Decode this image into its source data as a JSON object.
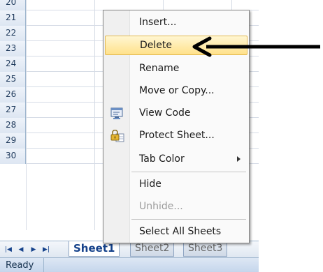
{
  "grid": {
    "rows": [
      "20",
      "21",
      "22",
      "23",
      "24",
      "25",
      "26",
      "27",
      "28",
      "29",
      "30"
    ]
  },
  "context_menu": {
    "items": [
      {
        "label": "Insert...",
        "state": "normal"
      },
      {
        "label": "Delete",
        "state": "highlighted"
      },
      {
        "label": "Rename",
        "state": "normal"
      },
      {
        "label": "Move or Copy...",
        "state": "normal"
      },
      {
        "label": "View Code",
        "state": "normal",
        "icon": "view-code-icon"
      },
      {
        "label": "Protect Sheet...",
        "state": "normal",
        "icon": "protect-sheet-icon"
      },
      {
        "label": "Tab Color",
        "state": "normal",
        "submenu": true
      },
      {
        "label": "Hide",
        "state": "normal"
      },
      {
        "label": "Unhide...",
        "state": "disabled"
      },
      {
        "label": "Select All Sheets",
        "state": "normal"
      }
    ]
  },
  "sheet_tabs": {
    "tabs": [
      "Sheet1",
      "Sheet2",
      "Sheet3"
    ],
    "active": "Sheet1"
  },
  "status_bar": {
    "status": "Ready"
  },
  "colors": {
    "highlight": "#ffe18a",
    "annotation_arrow": "#000000",
    "header_blue": "#dde6f2"
  }
}
